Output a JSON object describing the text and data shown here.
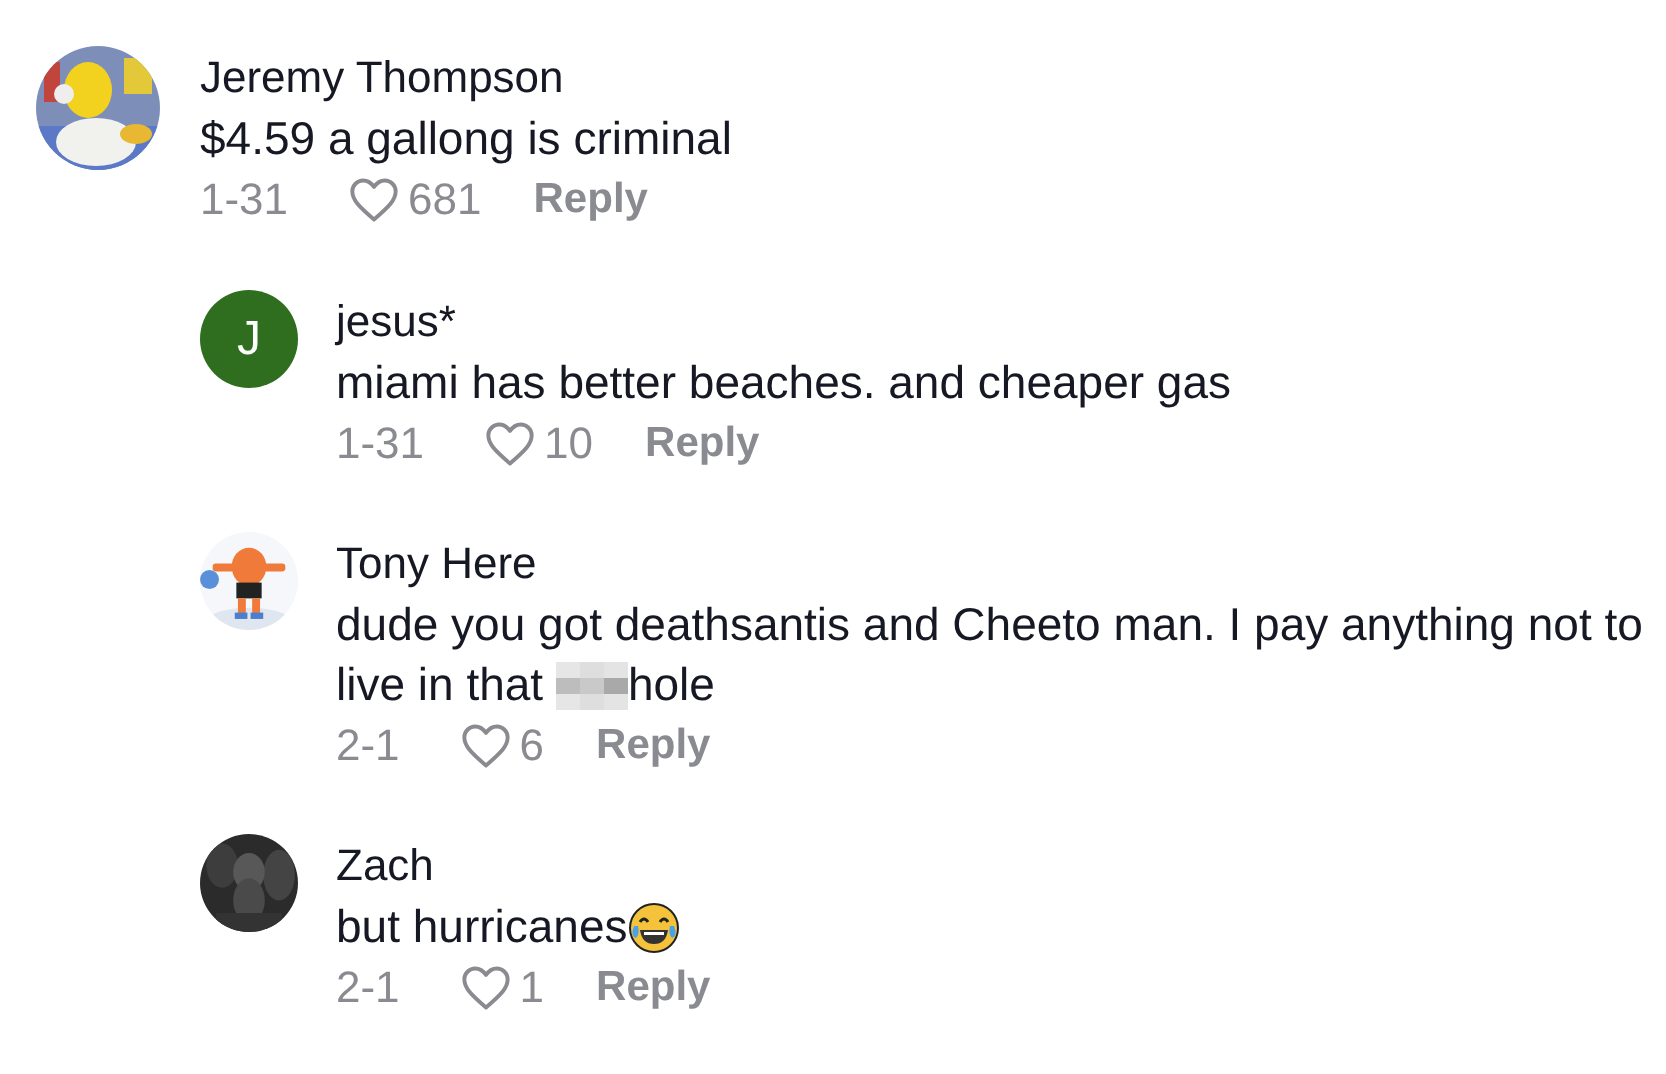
{
  "comments": [
    {
      "author": "Jeremy Thompson",
      "avatar": {
        "kind": "picture"
      },
      "segments": [
        {
          "kind": "text",
          "text": "$4.59 a gallong is criminal"
        }
      ],
      "date": "1-31",
      "liked": false,
      "likes": "681",
      "reply": "Reply",
      "replies": [
        {
          "author": "jesus*",
          "avatar": {
            "kind": "letter",
            "letter": "J"
          },
          "segments": [
            {
              "kind": "text",
              "text": "miami has better beaches. and cheaper gas"
            }
          ],
          "date": "1-31",
          "liked": false,
          "likes": "10",
          "reply": "Reply"
        },
        {
          "author": "Tony Here",
          "avatar": {
            "kind": "picture"
          },
          "segments": [
            {
              "kind": "text",
              "text": "dude you got deathsantis and Cheeto man. I pay anything not to live in that"
            },
            {
              "kind": "censored"
            },
            {
              "kind": "text",
              "text": "hole"
            }
          ],
          "date": "2-1",
          "liked": false,
          "likes": "6",
          "reply": "Reply"
        },
        {
          "author": "Zach",
          "avatar": {
            "kind": "picture"
          },
          "segments": [
            {
              "kind": "text",
              "text": "but hurricanes"
            },
            {
              "kind": "emoji"
            }
          ],
          "date": "2-1",
          "liked": false,
          "likes": "1",
          "reply": "Reply"
        }
      ]
    }
  ]
}
